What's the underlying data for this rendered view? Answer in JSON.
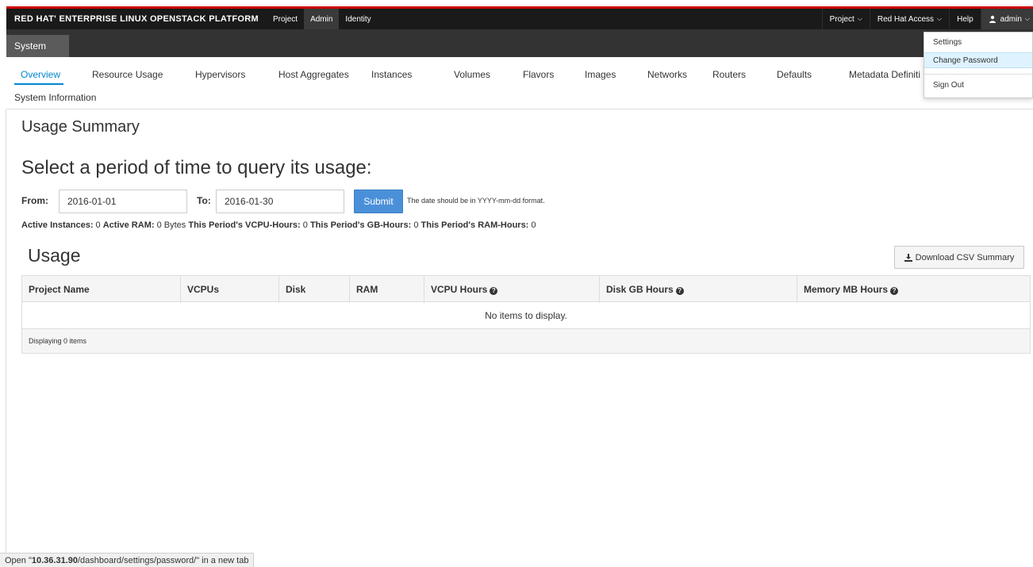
{
  "topbar": {
    "brand": "RED HAT' ENTERPRISE LINUX OPENSTACK PLATFORM",
    "nav": [
      "Project",
      "Admin",
      "Identity"
    ],
    "active_nav": "Admin",
    "right": {
      "project": "Project",
      "redhat_access": "Red Hat Access",
      "help": "Help",
      "user": "admin"
    }
  },
  "subbar": {
    "system": "System"
  },
  "tabs": {
    "items": [
      "Overview",
      "Resource Usage",
      "Hypervisors",
      "Host Aggregates",
      "Instances",
      "Volumes",
      "Flavors",
      "Images",
      "Networks",
      "Routers",
      "Defaults",
      "Metadata Definiti",
      "System Information"
    ],
    "active": "Overview"
  },
  "user_menu": {
    "items": [
      "Settings",
      "Change Password",
      "Sign Out"
    ],
    "highlighted": "Change Password"
  },
  "main": {
    "heading": "Usage Summary",
    "query_heading": "Select a period of time to query its usage:",
    "from_label": "From:",
    "from_value": "2016-01-01",
    "to_label": "To:",
    "to_value": "2016-01-30",
    "submit_label": "Submit",
    "date_hint": "The date should be in YYYY-mm-dd format.",
    "stats": {
      "active_instances_label": "Active Instances:",
      "active_instances": "0",
      "active_ram_label": "Active RAM:",
      "active_ram": "0 Bytes",
      "vcpu_hours_label": "This Period's VCPU-Hours:",
      "vcpu_hours": "0",
      "gb_hours_label": "This Period's GB-Hours:",
      "gb_hours": "0",
      "ram_hours_label": "This Period's RAM-Hours:",
      "ram_hours": "0"
    },
    "usage_heading": "Usage",
    "csv_button": "Download CSV Summary",
    "table": {
      "columns": [
        "Project Name",
        "VCPUs",
        "Disk",
        "RAM",
        "VCPU Hours",
        "Disk GB Hours",
        "Memory MB Hours"
      ],
      "empty_message": "No items to display.",
      "footer": "Displaying 0 items"
    }
  },
  "statusbar": {
    "prefix": "Open \"",
    "host": "10.36.31.90",
    "path": "/dashboard/settings/password/\" in a new tab"
  },
  "colors": {
    "accent": "#0088ce",
    "brand_red": "#cc0000",
    "topbar": "#1a1a1a",
    "submit": "#4a90d9",
    "menu_highlight": "#def3ff"
  },
  "icons": {
    "user": "user-icon",
    "download": "download-icon",
    "help": "question-circle-icon",
    "caret": "chevron-down-icon"
  }
}
